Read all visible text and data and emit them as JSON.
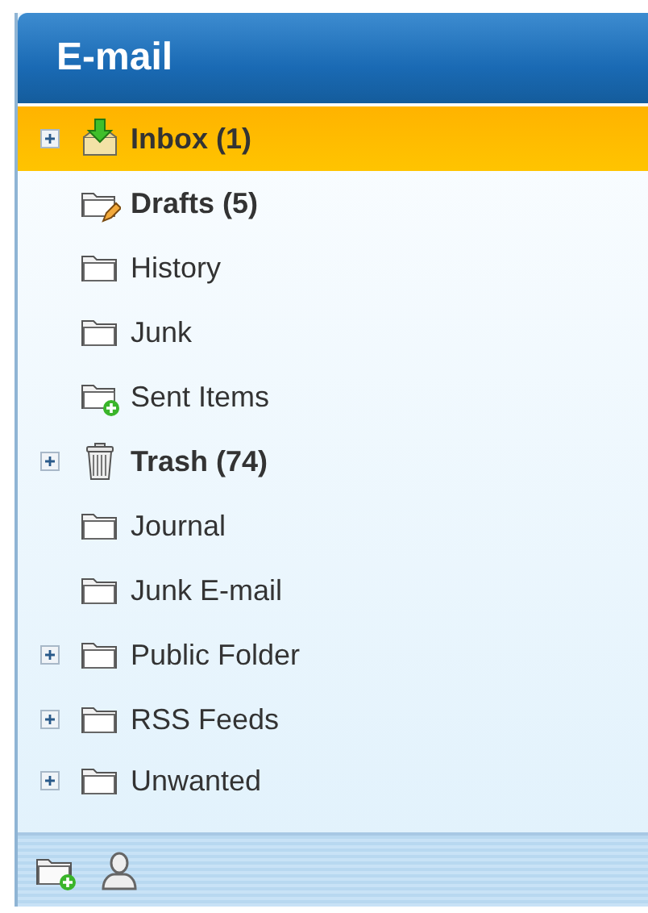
{
  "panel": {
    "title": "E-mail"
  },
  "folders": [
    {
      "label": "Inbox (1)",
      "kind": "inbox",
      "expandable": true,
      "bold": true,
      "selected": true
    },
    {
      "label": "Drafts (5)",
      "kind": "drafts",
      "expandable": false,
      "bold": true,
      "selected": false
    },
    {
      "label": "History",
      "kind": "folder",
      "expandable": false,
      "bold": false,
      "selected": false
    },
    {
      "label": "Junk",
      "kind": "folder",
      "expandable": false,
      "bold": false,
      "selected": false
    },
    {
      "label": "Sent Items",
      "kind": "sent",
      "expandable": false,
      "bold": false,
      "selected": false
    },
    {
      "label": "Trash (74)",
      "kind": "trash",
      "expandable": true,
      "bold": true,
      "selected": false
    },
    {
      "label": "Journal",
      "kind": "folder",
      "expandable": false,
      "bold": false,
      "selected": false
    },
    {
      "label": "Junk E-mail",
      "kind": "folder",
      "expandable": false,
      "bold": false,
      "selected": false
    },
    {
      "label": "Public Folder",
      "kind": "folder",
      "expandable": true,
      "bold": false,
      "selected": false
    },
    {
      "label": "RSS Feeds",
      "kind": "folder",
      "expandable": true,
      "bold": false,
      "selected": false
    },
    {
      "label": "Unwanted",
      "kind": "folder",
      "expandable": true,
      "bold": false,
      "selected": false
    }
  ]
}
